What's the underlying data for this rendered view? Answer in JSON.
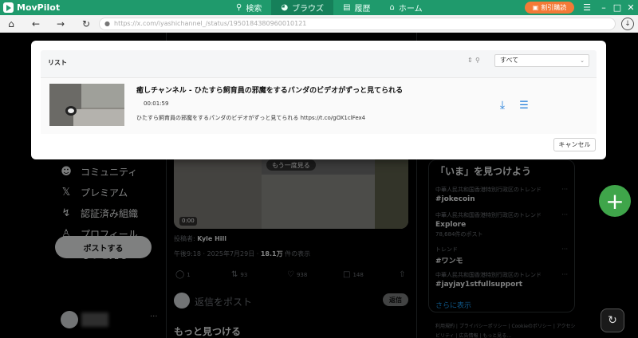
{
  "app": {
    "name": "MovPilot"
  },
  "topnav": {
    "tabs": [
      {
        "label": "検索",
        "icon": "search-icon"
      },
      {
        "label": "ブラウズ",
        "icon": "globe-icon",
        "active": true
      },
      {
        "label": "履歴",
        "icon": "history-icon"
      },
      {
        "label": "ホーム",
        "icon": "home-icon"
      }
    ]
  },
  "promo": {
    "label": "割引購読"
  },
  "browser": {
    "url": "https://x.com/iyashichannel_/status/1950184380960010121"
  },
  "sidebar": {
    "items": [
      {
        "label": "コミュニティ",
        "icon": "community-icon"
      },
      {
        "label": "プレミアム",
        "icon": "x-logo-icon"
      },
      {
        "label": "認証済み組織",
        "icon": "lightning-icon"
      },
      {
        "label": "プロフィール",
        "icon": "person-icon"
      },
      {
        "label": "もっと見る",
        "icon": "more-circle-icon"
      }
    ],
    "post_button": "ポストする"
  },
  "tweet": {
    "replay_label": "もう一度見る",
    "video_time": "0:00",
    "posted_by_prefix": "投稿者:",
    "posted_by": "Kyle Hill",
    "timestamp": "午後9:18 · 2025年7月29日 · ",
    "views": "18.1万",
    "views_suffix": " 件の表示",
    "actions": {
      "reply_count": "1",
      "retweet_count": "93",
      "like_count": "938",
      "bookmark_count": "148"
    },
    "reply_placeholder": "返信をポスト",
    "reply_button": "返信",
    "discover_heading": "もっと見つける"
  },
  "trends": {
    "heading": "「いま」を見つけよう",
    "items": [
      {
        "context": "中華人民共和国香港特別行政区のトレンド",
        "name": "#jokecoin",
        "count": ""
      },
      {
        "context": "中華人民共和国香港特別行政区のトレンド",
        "name": "Explore",
        "count": "78,684件のポスト"
      },
      {
        "context": "トレンド",
        "name": "#ワンモ",
        "count": ""
      },
      {
        "context": "中華人民共和国香港特別行政区のトレンド",
        "name": "#jayjay1stfullsupport",
        "count": ""
      }
    ],
    "show_more": "さらに表示",
    "footer": "利用規約 | プライバシーポリシー | Cookieのポリシー | アクセシビリティ | 広告情報 | もっと見る…"
  },
  "modal": {
    "title": "リスト",
    "filter_value": "すべて",
    "item": {
      "title": "癒しチャンネル - ひたすら飼育員の邪魔をするパンダのビデオがずっと見てられる",
      "duration": "00:01:59",
      "description": "ひたすら飼育員の邪魔をするパンダのビデオがずっと見てられる https://t.co/gOX1clFex4"
    },
    "cancel_button": "キャンセル"
  },
  "colors": {
    "brand": "#1f9a6c",
    "promo": "#f47a37",
    "accent_blue": "#1e7bd8",
    "fab_green": "#3fa54a"
  }
}
